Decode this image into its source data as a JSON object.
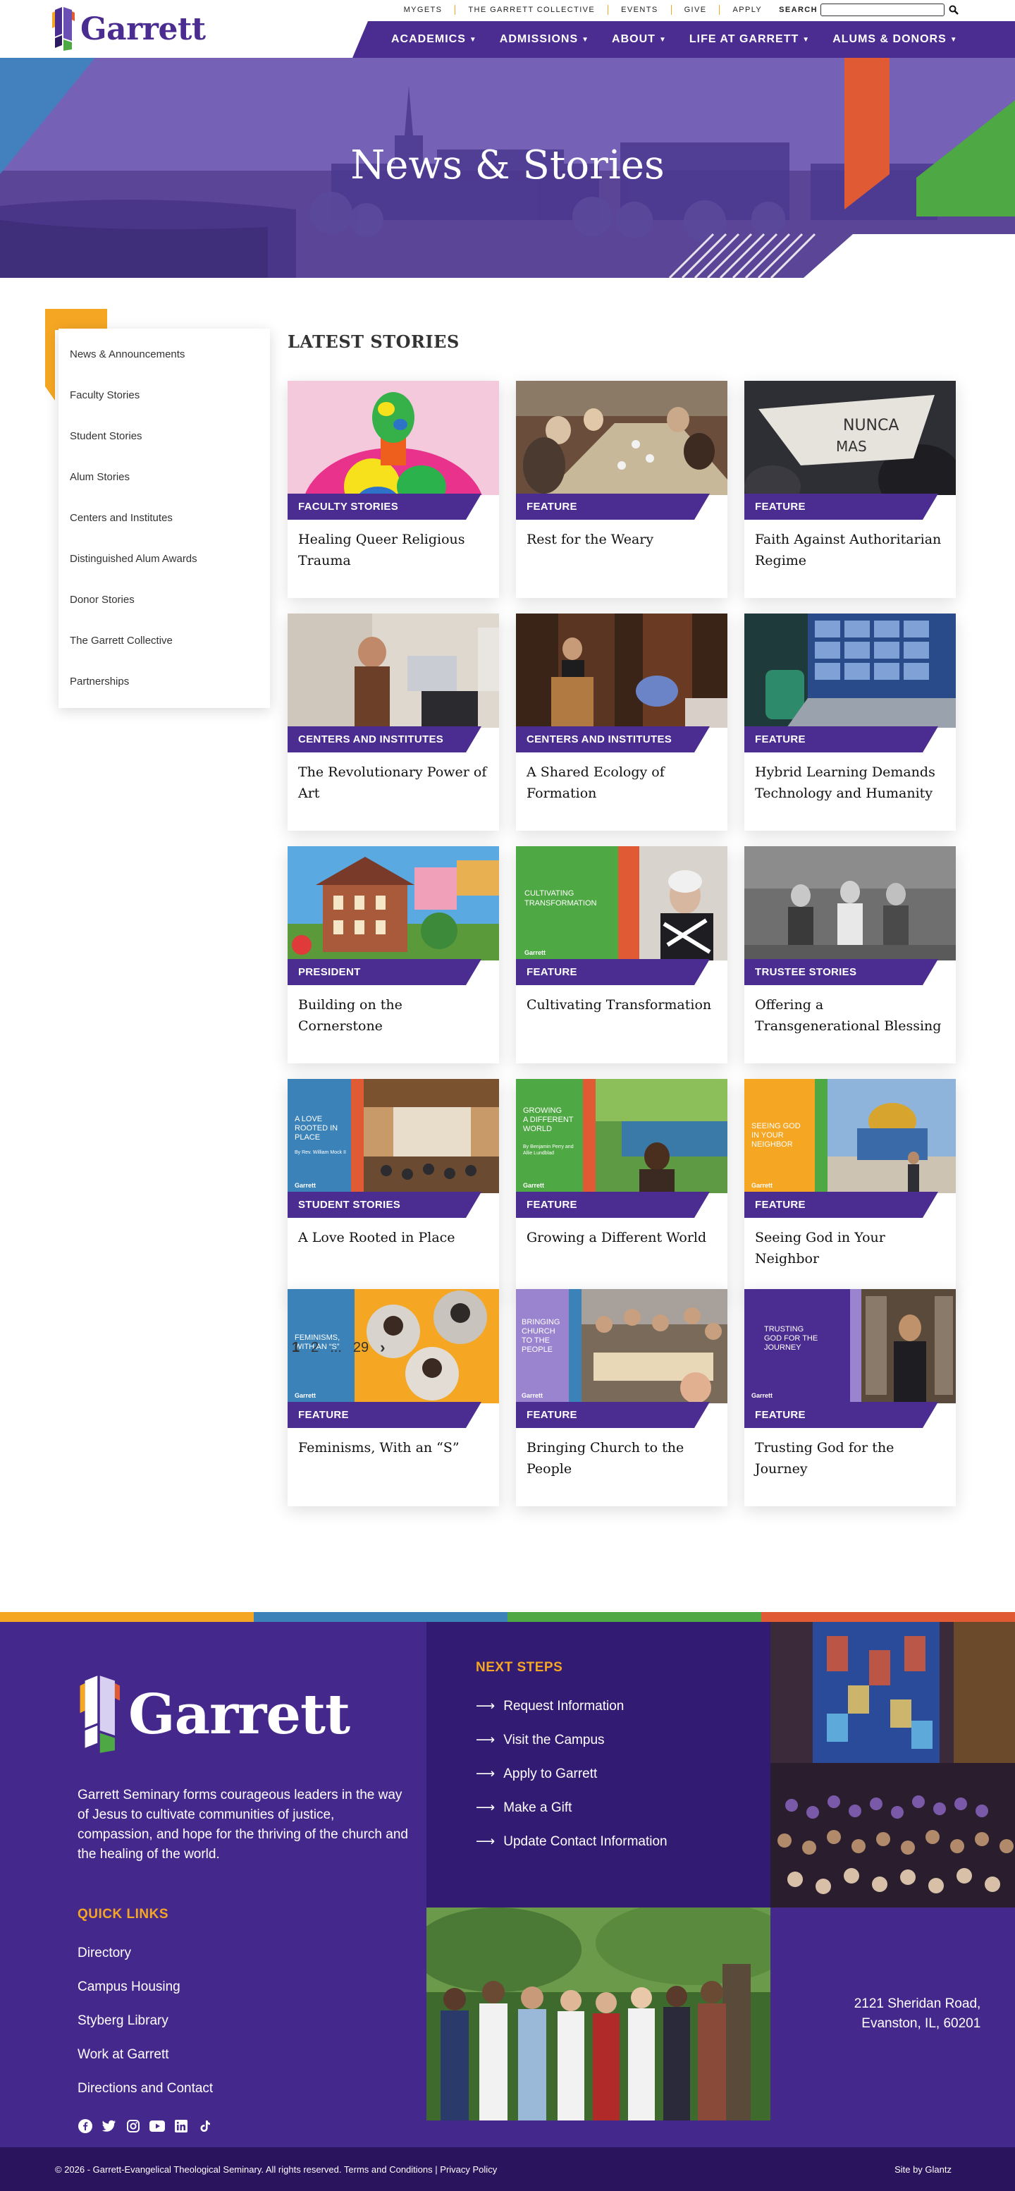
{
  "brand": {
    "name": "Garrett",
    "purple": "#4b2c91",
    "gold": "#f5a623",
    "orange": "#e05a33",
    "green": "#4ea843",
    "blue": "#3b82b8"
  },
  "utility": {
    "links": [
      "MYGETS",
      "THE GARRETT COLLECTIVE",
      "EVENTS",
      "GIVE",
      "APPLY"
    ],
    "search_label": "SEARCH",
    "search_value": ""
  },
  "nav": [
    "ACADEMICS",
    "ADMISSIONS",
    "ABOUT",
    "LIFE AT GARRETT",
    "ALUMS & DONORS"
  ],
  "hero": {
    "title": "News & Stories"
  },
  "sidebar": [
    "News & Announcements",
    "Faculty Stories",
    "Student Stories",
    "Alum Stories",
    "Centers and Institutes",
    "Distinguished Alum Awards",
    "Donor Stories",
    "The Garrett Collective",
    "Partnerships"
  ],
  "latest_heading": "LATEST STORIES",
  "cards": [
    {
      "tag": "FACULTY STORIES",
      "title": "Healing Queer Religious Trauma"
    },
    {
      "tag": "FEATURE",
      "title": "Rest for the Weary"
    },
    {
      "tag": "FEATURE",
      "title": "Faith Against Authoritarian Regime"
    },
    {
      "tag": "CENTERS AND INSTITUTES",
      "title": "The Revolutionary Power of Art"
    },
    {
      "tag": "CENTERS AND INSTITUTES",
      "title": "A Shared Ecology of Formation"
    },
    {
      "tag": "FEATURE",
      "title": "Hybrid Learning Demands Technology and Humanity"
    },
    {
      "tag": "PRESIDENT",
      "title": "Building on the Cornerstone"
    },
    {
      "tag": "FEATURE",
      "title": "Cultivating Transformation"
    },
    {
      "tag": "TRUSTEE STORIES",
      "title": "Offering a Transgenerational Blessing"
    },
    {
      "tag": "STUDENT STORIES",
      "title": "A Love Rooted in Place"
    },
    {
      "tag": "FEATURE",
      "title": "Growing a Different World"
    },
    {
      "tag": "FEATURE",
      "title": "Seeing God in Your Neighbor"
    },
    {
      "tag": "FEATURE",
      "title": "Feminisms, With an “S”"
    },
    {
      "tag": "FEATURE",
      "title": "Bringing Church to the People"
    },
    {
      "tag": "FEATURE",
      "title": "Trusting God for the Journey"
    }
  ],
  "image_text": {
    "sign": "NUNCA MAS",
    "cultivating": "CULTIVATING TRANSFORMATION",
    "love": "A LOVE ROOTED IN PLACE",
    "love_byline": "By Rev. William Mock II",
    "growing": "GROWING A DIFFERENT WORLD",
    "growing_byline": "By Benjamin Perry and Allie Lundblad",
    "seeing": "SEEING GOD IN YOUR NEIGHBOR",
    "feminisms": "FEMINISMS, WITH AN “S”",
    "bringing": "BRINGING CHURCH TO THE PEOPLE",
    "trusting": "TRUSTING GOD FOR THE JOURNEY",
    "brand_small": "Garrett"
  },
  "pagination": {
    "current": "1",
    "next": "2",
    "ellipsis": "...",
    "last": "29"
  },
  "footer": {
    "mission": "Garrett Seminary forms courageous leaders in the way of Jesus to cultivate communities of justice, compassion, and hope for the thriving of the church and the healing of the world.",
    "quick_links_heading": "QUICK LINKS",
    "quick_links": [
      "Directory",
      "Campus Housing",
      "Styberg Library",
      "Work at Garrett",
      "Directions and Contact"
    ],
    "next_steps_heading": "NEXT STEPS",
    "next_steps": [
      "Request Information",
      "Visit the Campus",
      "Apply to Garrett",
      "Make a Gift",
      "Update Contact Information"
    ],
    "address_line1": "2121 Sheridan Road,",
    "address_line2": "Evanston, IL, 60201",
    "social_icons": [
      "facebook-icon",
      "twitter-icon",
      "instagram-icon",
      "youtube-icon",
      "linkedin-icon",
      "tiktok-icon"
    ]
  },
  "copyright": {
    "text": "© 2026 - Garrett-Evangelical Theological Seminary. All rights reserved.",
    "terms": "Terms and Conditions",
    "separator": "|",
    "privacy": "Privacy Policy",
    "credit": "Site by Glantz"
  }
}
